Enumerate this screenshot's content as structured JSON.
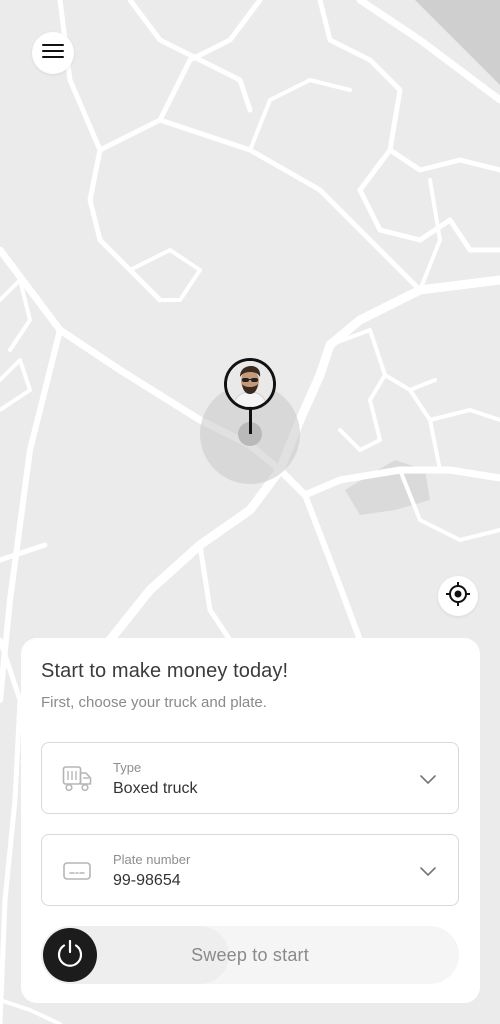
{
  "map": {
    "background_color": "#ebebeb",
    "road_color": "#ffffff",
    "block_color": "#dcdcdc"
  },
  "header": {
    "menu_icon": "hamburger-menu-icon"
  },
  "map_controls": {
    "locate_icon": "crosshair-locate-icon"
  },
  "driver_pin": {
    "avatar_icon": "driver-avatar"
  },
  "panel": {
    "title": "Start to make money today!",
    "subtitle": "First, choose your truck and plate.",
    "type_field": {
      "icon": "truck-icon",
      "label": "Type",
      "value": "Boxed truck"
    },
    "plate_field": {
      "icon": "license-plate-icon",
      "label": "Plate number",
      "value": "99-98654"
    },
    "start_slider": {
      "label": "Sweep to start",
      "knob_icon": "power-icon"
    }
  },
  "colors": {
    "knob": "#1c1c1c",
    "text_primary": "#3b3b3b",
    "text_secondary": "#8a8a8a",
    "border": "#d9d9d9"
  }
}
